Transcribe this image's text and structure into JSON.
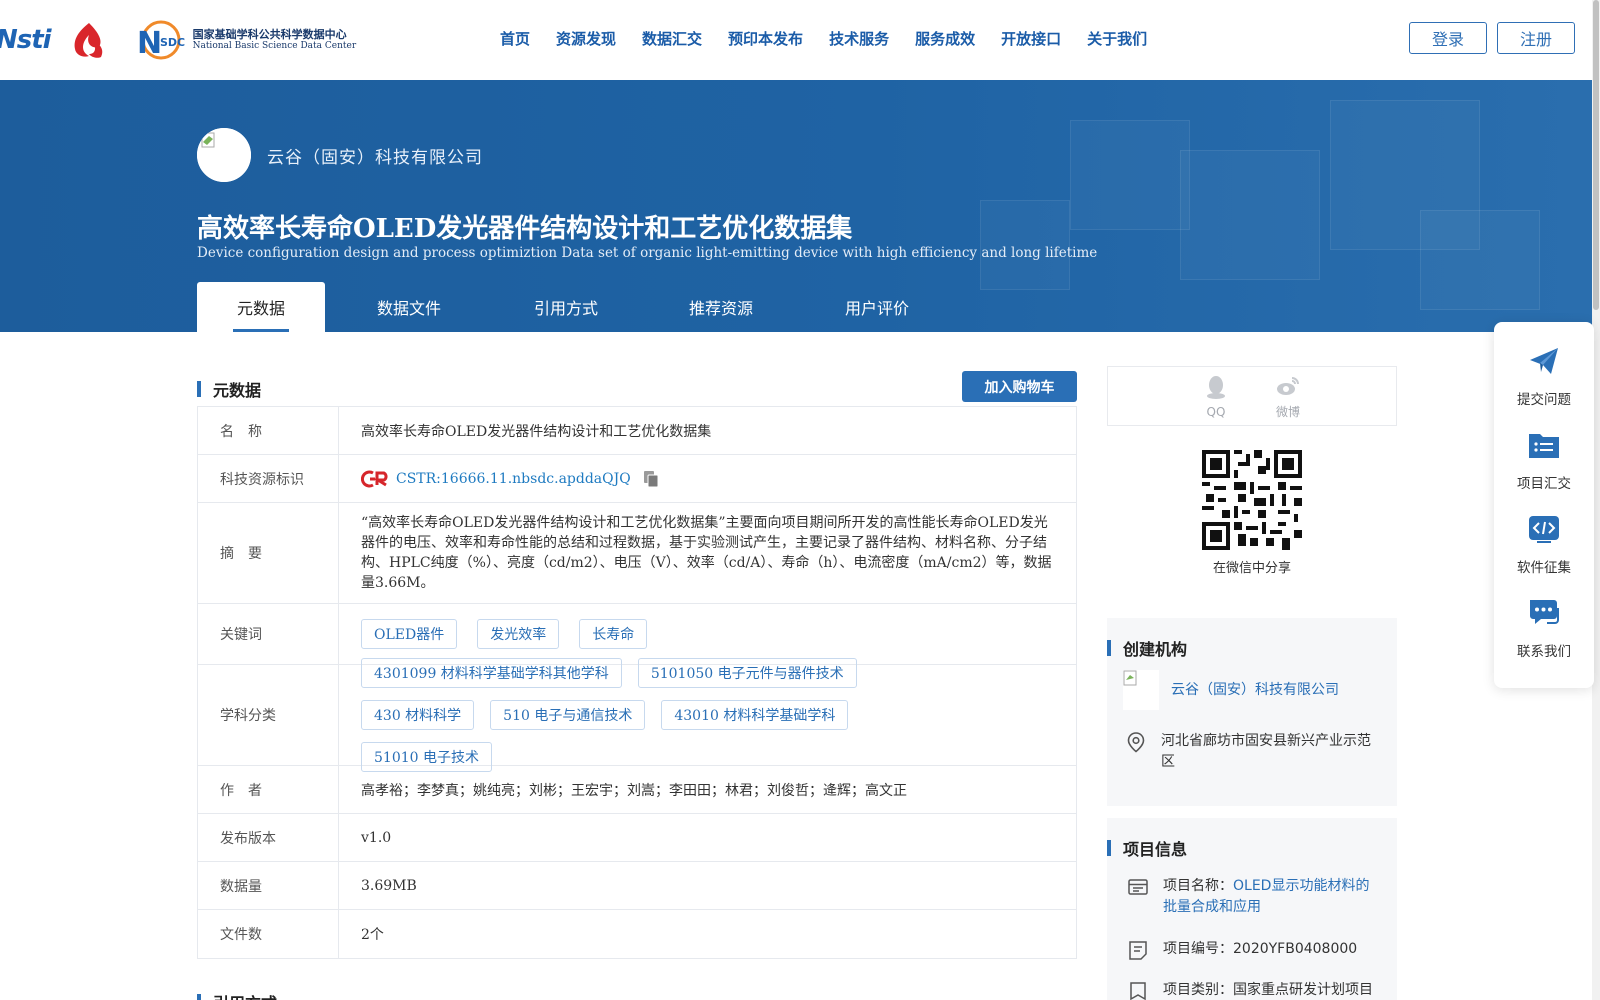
{
  "header": {
    "logos": {
      "nstl": "Nsti",
      "nsdc_mark": "SDC",
      "nsdc_cn": "国家基础学科公共科学数据中心",
      "nsdc_en": "National Basic Science Data Center"
    },
    "nav": [
      "首页",
      "资源发现",
      "数据汇交",
      "预印本发布",
      "技术服务",
      "服务成效",
      "开放接口",
      "关于我们"
    ],
    "login": "登录",
    "register": "注册"
  },
  "banner": {
    "org_name": "云谷（固安）科技有限公司",
    "title": "高效率长寿命OLED发光器件结构设计和工艺优化数据集",
    "subtitle": "Device configuration design and process optimiztion Data set of organic light-emitting device with high efficiency and long lifetime",
    "tabs": [
      "元数据",
      "数据文件",
      "引用方式",
      "推荐资源",
      "用户评价"
    ],
    "active_tab": 0
  },
  "metadata": {
    "section_title": "元数据",
    "cart_button": "加入购物车",
    "rows": {
      "name": {
        "label": "名　称",
        "value": "高效率长寿命OLED发光器件结构设计和工艺优化数据集"
      },
      "cstr": {
        "label": "科技资源标识",
        "value": "CSTR:16666.11.nbsdc.apddaQJQ"
      },
      "abstract": {
        "label": "摘　要",
        "value": "“高效率长寿命OLED发光器件结构设计和工艺优化数据集”主要面向项目期间所开发的高性能长寿命OLED发光器件的电压、效率和寿命性能的总结和过程数据，基于实验测试产生，主要记录了器件结构、材料名称、分子结构、HPLC纯度（%）、亮度（cd/m2）、电压（V）、效率（cd/A）、寿命（h）、电流密度（mA/cm2）等，数据量3.66M。"
      },
      "keywords": {
        "label": "关键词",
        "values": [
          "OLED器件",
          "发光效率",
          "长寿命"
        ]
      },
      "subjects": {
        "label": "学科分类",
        "values": [
          "4301099 材料科学基础学科其他学科",
          "5101050 电子元件与器件技术",
          "430 材料科学",
          "510 电子与通信技术",
          "43010 材料科学基础学科",
          "51010 电子技术"
        ]
      },
      "authors": {
        "label": "作　者",
        "value": "高孝裕；李梦真；姚纯亮；刘彬；王宏宇；刘嵩；李田田；林君；刘俊哲；逄辉；高文正"
      },
      "version": {
        "label": "发布版本",
        "value": "v1.0"
      },
      "size": {
        "label": "数据量",
        "value": "3.69MB"
      },
      "files": {
        "label": "文件数",
        "value": "2个"
      }
    },
    "next_section_title": "引用方式"
  },
  "sidebar": {
    "share": {
      "qq": "QQ",
      "weibo": "微博",
      "wechat_caption": "在微信中分享"
    },
    "creator": {
      "title": "创建机构",
      "org": "云谷（固安）科技有限公司",
      "address": "河北省廊坊市固安县新兴产业示范区"
    },
    "project": {
      "title": "项目信息",
      "name_label": "项目名称：",
      "name_value": "OLED显示功能材料的批量合成和应用",
      "code_label": "项目编号：",
      "code_value": "2020YFB0408000",
      "type_label": "项目类别：",
      "type_value": "国家重点研发计划项目"
    }
  },
  "float_panel": [
    "提交问题",
    "项目汇交",
    "软件征集",
    "联系我们"
  ],
  "colors": {
    "brand_blue": "#2a6fb6",
    "banner_blue": "#1f63a4",
    "link_blue": "#1f7bc1",
    "cstr_red": "#d6262b"
  }
}
